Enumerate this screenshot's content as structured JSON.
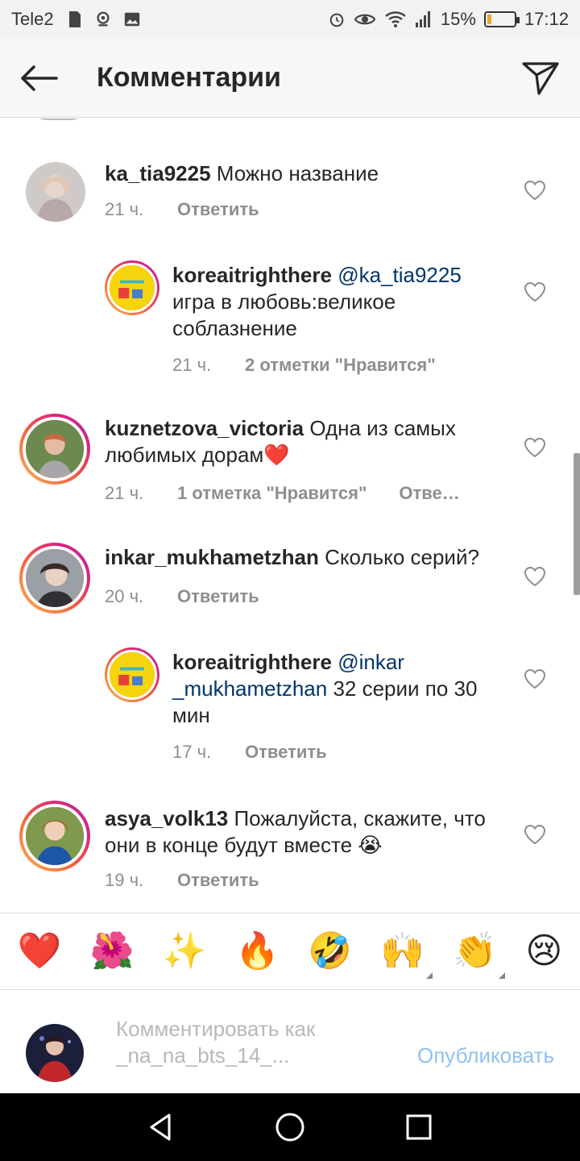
{
  "status_bar": {
    "carrier": "Tele2",
    "battery": "15%",
    "battery_level": 0.15,
    "battery_color": "#f5a623",
    "time": "17:12",
    "icons": [
      "sdcard-icon",
      "location-icon",
      "image-icon",
      "alarm-icon",
      "eye-icon",
      "wifi-icon",
      "signal-icon",
      "battery-icon"
    ]
  },
  "header": {
    "title": "Комментарии",
    "back_icon": "arrow-left-icon",
    "send_icon": "paper-plane-icon"
  },
  "comments": [
    {
      "username": "ka_tia9225",
      "mention": "",
      "text": " Можно название",
      "time": "21 ч.",
      "likes": "",
      "reply": "Ответить",
      "is_reply": false
    },
    {
      "username": "koreaitrighthere",
      "mention": "@ka_tia9225",
      "text": "игра в любовь:великое соблазнение",
      "time": "21 ч.",
      "likes": "2 отметки \"Нравится\"",
      "reply": "",
      "is_reply": true
    },
    {
      "username": "kuznetzova_victoria",
      "mention": "",
      "text": " Одна из самых любимых дорам❤️",
      "time": "21 ч.",
      "likes": "1 отметка \"Нравится\"",
      "reply": "Отве…",
      "is_reply": false
    },
    {
      "username": "inkar_mukhametzhan",
      "mention": "",
      "text": " Сколько серий?",
      "time": "20 ч.",
      "likes": "",
      "reply": "Ответить",
      "is_reply": false
    },
    {
      "username": "koreaitrighthere",
      "mention": "@inkar _mukhametzhan",
      "text": " 32 серии по 30 мин",
      "time": "17 ч.",
      "likes": "",
      "reply": "Ответить",
      "is_reply": true
    },
    {
      "username": "asya_volk13",
      "mention": "",
      "text": " Пожалуйста, скажите, что они в конце будут вместе 😭",
      "time": "19 ч.",
      "likes": "",
      "reply": "Ответить",
      "is_reply": false
    }
  ],
  "emoji_bar": [
    "❤️",
    "🌺",
    "✨",
    "🔥",
    "🤣",
    "🙌",
    "👏",
    "😢"
  ],
  "input": {
    "placeholder": "Комментировать как _na_na_bts_14_...",
    "publish_label": "Опубликовать"
  },
  "nav": {
    "back_icon": "triangle-back-icon",
    "home_icon": "circle-home-icon",
    "recents_icon": "square-recents-icon"
  },
  "colors": {
    "mention": "#003569",
    "meta": "#8e8e8e",
    "publish": "#8fc1f0"
  }
}
